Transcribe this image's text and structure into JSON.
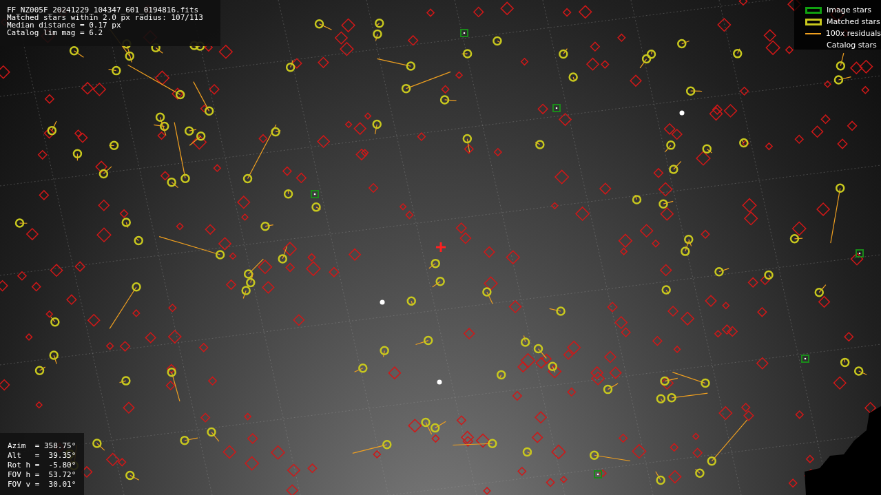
{
  "info_lines": [
    "FF_NZ005F_20241229_104347_601_0194816.fits",
    "Matched stars within 2.0 px radius: 107/113",
    "Median distance = 0.17 px",
    "Catalog lim mag = 6.2"
  ],
  "legend": [
    {
      "kind": "box",
      "color": "#10a010",
      "label": "Image stars"
    },
    {
      "kind": "box",
      "color": "#c8c81e",
      "label": "Matched stars"
    },
    {
      "kind": "line",
      "color": "#f0a020",
      "label": "100x residuals"
    },
    {
      "kind": "none",
      "label": "Catalog stars"
    }
  ],
  "pointing": [
    "Azim  = 358.75°",
    "Alt   =  39.35°",
    "Rot h =  -5.80°",
    "FOV h =  53.72°",
    "FOV v =  30.01°"
  ]
}
